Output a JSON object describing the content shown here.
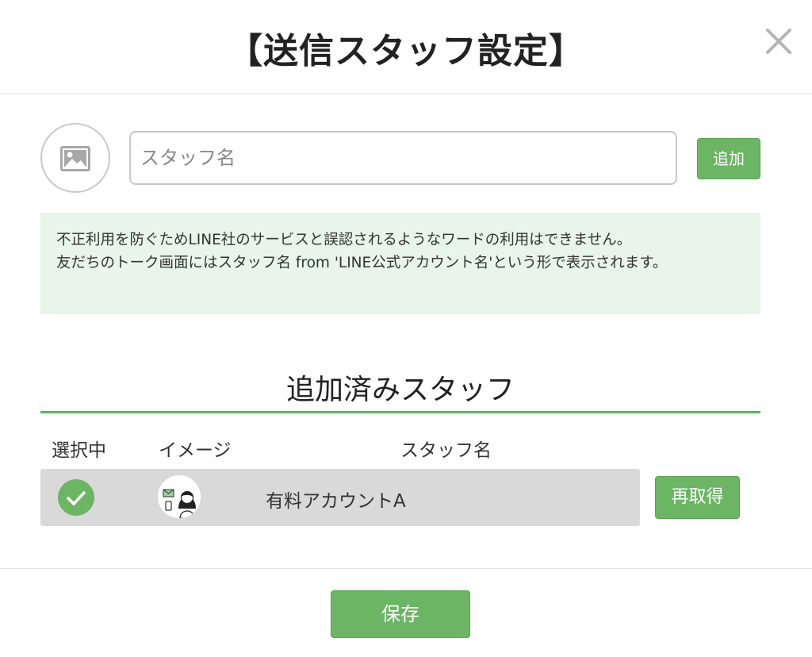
{
  "header": {
    "title": "【送信スタッフ設定】",
    "close_icon": "close-icon"
  },
  "add_staff": {
    "avatar_icon": "image-placeholder-icon",
    "name_placeholder": "スタッフ名",
    "name_value": "",
    "add_label": "追加"
  },
  "notice": {
    "line1": "不正利用を防ぐためLINE社のサービスと誤認されるようなワードの利用はできません。",
    "line2": "友だちのトーク画面にはスタッフ名 from 'LINE公式アカウント名'という形で表示されます。"
  },
  "staff_list": {
    "title": "追加済みスタッフ",
    "columns": [
      "選択中",
      "イメージ",
      "スタッフ名"
    ],
    "rows": [
      {
        "selected": true,
        "selected_icon": "check-circle-icon",
        "avatar": "staff-avatar-illustration",
        "name": "有料アカウントA",
        "action_label": "再取得"
      }
    ]
  },
  "footer": {
    "save_label": "保存"
  },
  "colors": {
    "accent": "#6cb565",
    "notice_bg": "#e8f5ea",
    "row_bg": "#d9d9d9",
    "rule": "#5cb55a"
  }
}
